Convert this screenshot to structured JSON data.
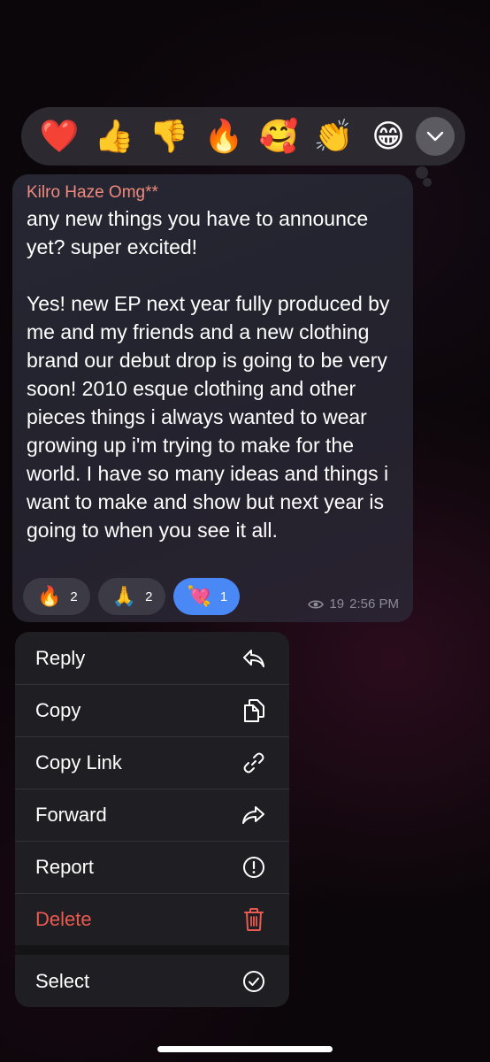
{
  "reaction_bar": {
    "emojis": [
      {
        "icon": "red-heart",
        "glyph": "❤️"
      },
      {
        "icon": "thumbs-up",
        "glyph": "👍"
      },
      {
        "icon": "thumbs-down",
        "glyph": "👎"
      },
      {
        "icon": "fire",
        "glyph": "🔥"
      },
      {
        "icon": "smiling-face-with-hearts",
        "glyph": "🥰"
      },
      {
        "icon": "clapping-hands",
        "glyph": "👏"
      },
      {
        "icon": "beaming-face",
        "glyph": "😁"
      }
    ],
    "expand_icon": "chevron-down-icon"
  },
  "message": {
    "sender": "Kilro Haze Omg**",
    "text": "any new things you have to announce yet? super excited!\n\nYes! new EP next year fully produced by me and my friends and a new clothing brand our debut drop is going to be very soon! 2010 esque clothing and other pieces things i always wanted to wear growing up i'm trying to make for the world. I have so many ideas and things i want to make and show but next year is going to when you see it all.",
    "reactions": [
      {
        "glyph": "🔥",
        "count": "2",
        "active": false
      },
      {
        "glyph": "🙏",
        "count": "2",
        "active": false
      },
      {
        "glyph": "💘",
        "count": "1",
        "active": true
      }
    ],
    "views": "19",
    "time": "2:56 PM"
  },
  "menu": {
    "reply": "Reply",
    "copy": "Copy",
    "copy_link": "Copy Link",
    "forward": "Forward",
    "report": "Report",
    "delete": "Delete",
    "select": "Select"
  },
  "colors": {
    "sender": "#f08a7e",
    "delete": "#ea5a51",
    "active_reaction": "#4a88f5"
  }
}
